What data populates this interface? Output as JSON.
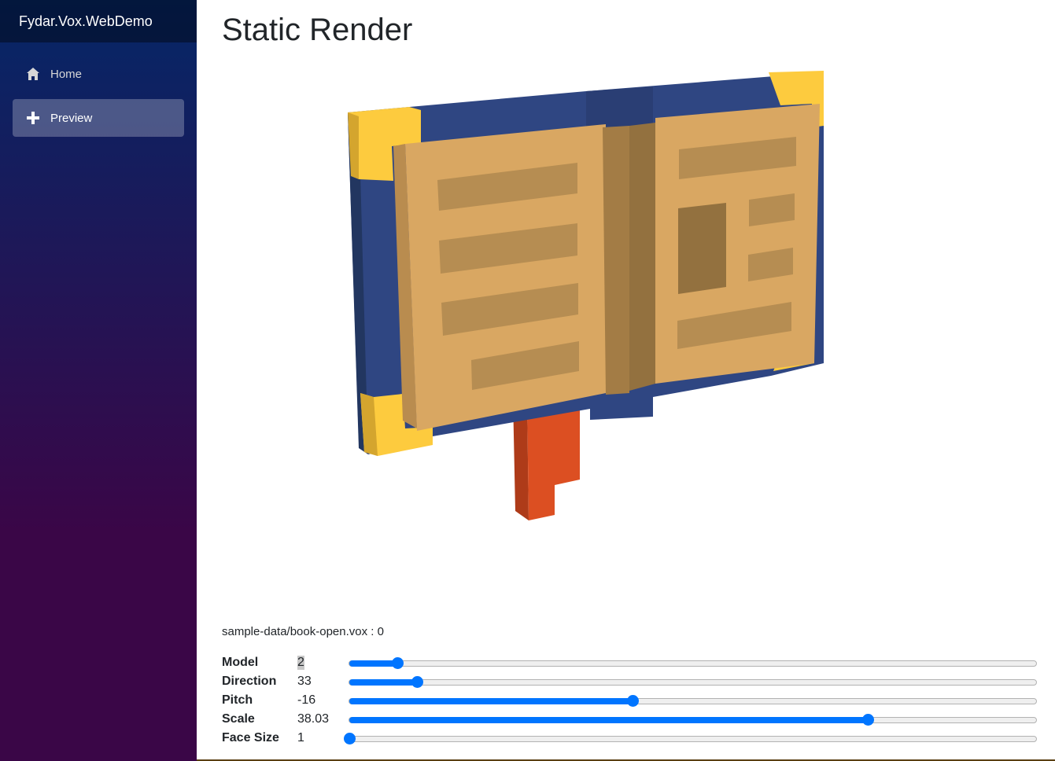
{
  "app": {
    "brand": "Fydar.Vox.WebDemo"
  },
  "nav": {
    "items": [
      {
        "label": "Home",
        "icon": "home-icon",
        "active": false
      },
      {
        "label": "Preview",
        "icon": "plus-icon",
        "active": true
      }
    ]
  },
  "page": {
    "title": "Static Render",
    "file_path": "sample-data/book-open.vox",
    "file_separator": " : ",
    "file_index": "0"
  },
  "controls": [
    {
      "name": "Model",
      "value": "2",
      "level": 0.07
    },
    {
      "name": "Direction",
      "value": "33",
      "level": 0.098
    },
    {
      "name": "Pitch",
      "value": "-16",
      "level": 0.412
    },
    {
      "name": "Scale",
      "value": "38.03",
      "level": 0.755
    },
    {
      "name": "Face Size",
      "value": "1",
      "level": 0.0
    }
  ],
  "colors": {
    "accent": "#0075ff",
    "cover_blue": "#2f4682",
    "cover_blue_dark": "#223660",
    "corner_yellow": "#fdcb3e",
    "corner_yellow_dark": "#d4a52e",
    "page_tan": "#d9a762",
    "page_tan_dark": "#b98c4f",
    "text_line": "#b68d52",
    "spine": "#93713f",
    "ribbon": "#dc4f22",
    "ribbon_dark": "#ae3b19"
  }
}
